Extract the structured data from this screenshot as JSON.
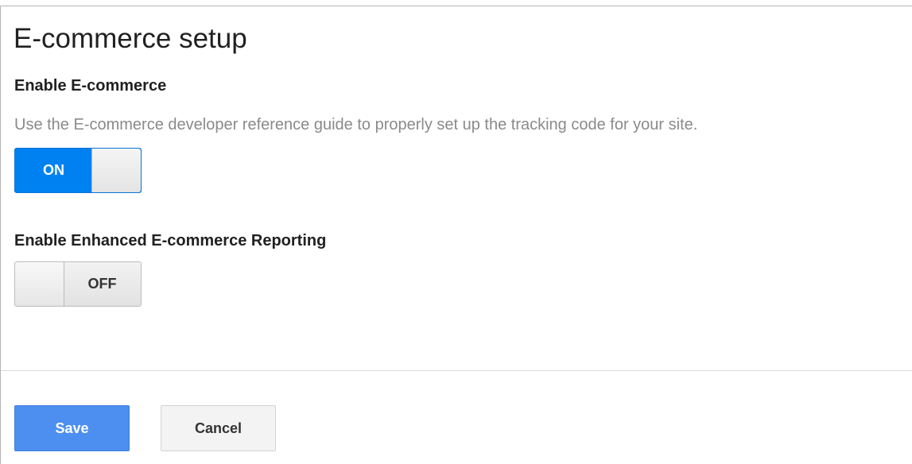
{
  "page": {
    "title": "E-commerce setup"
  },
  "ecommerce": {
    "heading": "Enable E-commerce",
    "help_text": "Use the E-commerce developer reference guide to properly set up the tracking code for your site.",
    "toggle_label": "ON",
    "toggle_state": true
  },
  "enhanced": {
    "heading": "Enable Enhanced E-commerce Reporting",
    "toggle_label": "OFF",
    "toggle_state": false
  },
  "actions": {
    "save_label": "Save",
    "cancel_label": "Cancel"
  },
  "colors": {
    "toggle_on": "#0081f1",
    "save_button": "#4c8ff0",
    "help_text": "#8a8a8a"
  }
}
